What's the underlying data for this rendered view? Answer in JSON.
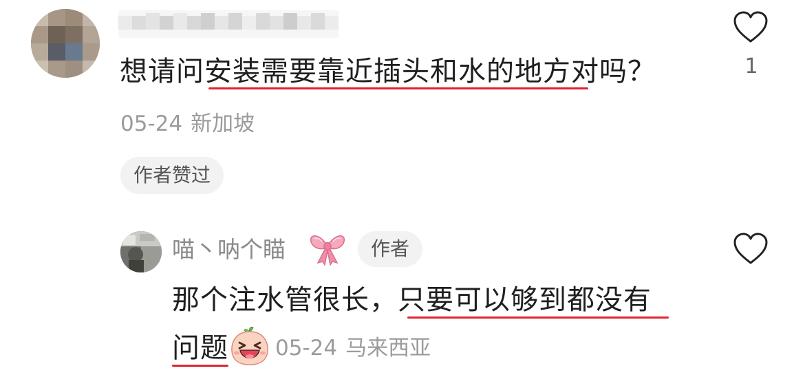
{
  "comment": {
    "text_plain_before": "想请问",
    "text_underlined": "安装需要靠近插头和水的地方",
    "text_plain_after": "对吗？",
    "date": "05-24",
    "location": "新加坡",
    "author_liked_label": "作者赞过",
    "like_count": "1"
  },
  "reply": {
    "username": "喵丶呐个瞄",
    "author_badge": "作者",
    "line1_plain": "那个注水管很长，",
    "line1_underlined": "只要可以够到都没有",
    "line2_underlined": "问题",
    "date": "05-24",
    "location": "马来西亚"
  },
  "icons": {
    "like": "heart-outline-icon",
    "bow": "pink-bow-icon",
    "emoji": "laughing-face-icon"
  },
  "colors": {
    "underline": "#e0232d",
    "meta_text": "#9b9b9b",
    "badge_bg": "#f2f2f2"
  }
}
